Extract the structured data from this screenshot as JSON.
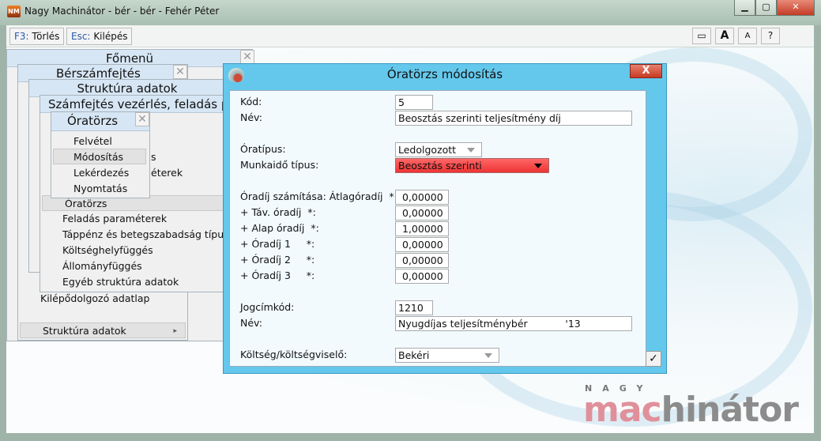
{
  "window": {
    "title": "Nagy Machinátor - bér - bér - Fehér Péter",
    "app_icon": "NM",
    "minimize": "▁",
    "maximize": "▢",
    "close": "✕"
  },
  "toolbar": {
    "delete_key": "F3:",
    "delete_label": "Törlés",
    "exit_key": "Esc:",
    "exit_label": "Kilépés",
    "window_btn": "▭",
    "font_large": "A",
    "font_small": "A",
    "help": "?"
  },
  "menus": {
    "fomenu": {
      "title": "Főmenü"
    },
    "berszamfejtes": {
      "title": "Bérszámfejtés",
      "items": [
        "Kilépődolgozó adatlap",
        "Struktúra adatok"
      ],
      "submenu_arrow": "▸"
    },
    "struktura": {
      "title": "Struktúra adatok"
    },
    "szamfejtes": {
      "title": "Számfejtés vezérlés, feladás pa",
      "items": [
        "Óratörzs",
        "Feladás paraméterek",
        "Táppénz és betegszabadság típus",
        "Költséghelyfüggés",
        "Állományfüggés",
        "Egyéb struktúra adatok"
      ],
      "hidden_fragments": [
        "s",
        "éterek"
      ]
    },
    "oratorzs": {
      "title": "Óratörzs",
      "items": [
        "Felvétel",
        "Módosítás",
        "Lekérdezés",
        "Nyomtatás"
      ]
    },
    "close": "✕"
  },
  "dialog": {
    "title": "Óratörzs módosítás",
    "close": "X",
    "ok": "✓",
    "kod": {
      "label": "Kód:",
      "value": "5"
    },
    "nev": {
      "label": "Név:",
      "value": "Beosztás szerinti teljesítmény díj"
    },
    "oratipus": {
      "label": "Óratípus:",
      "value": "Ledolgozott"
    },
    "munkaido": {
      "label": "Munkaidő típus:",
      "value": "Beosztás szerinti",
      "color": "#f04848"
    },
    "rates": [
      {
        "label": "Óradíj számítása: Átlagóradíj  *:",
        "value": "0,00000"
      },
      {
        "label": "+ Táv. óradíj  *:",
        "value": "0,00000"
      },
      {
        "label": "+ Alap óradíj  *:",
        "value": "1,00000"
      },
      {
        "label": "+ Óradíj 1     *:",
        "value": "0,00000"
      },
      {
        "label": "+ Óradíj 2     *:",
        "value": "0,00000"
      },
      {
        "label": "+ Óradíj 3     *:",
        "value": "0,00000"
      }
    ],
    "jogcimkod": {
      "label": "Jogcímkód:",
      "value": "1210"
    },
    "jogcim_nev": {
      "label": "Név:",
      "value": "Nyugdíjas teljesítménybér            '13"
    },
    "koltseg": {
      "label": "Költség/költségviselő:",
      "value": "Bekéri"
    }
  },
  "logo": {
    "small": "NAGY",
    "part1": "mac",
    "part2": "hinátor"
  }
}
